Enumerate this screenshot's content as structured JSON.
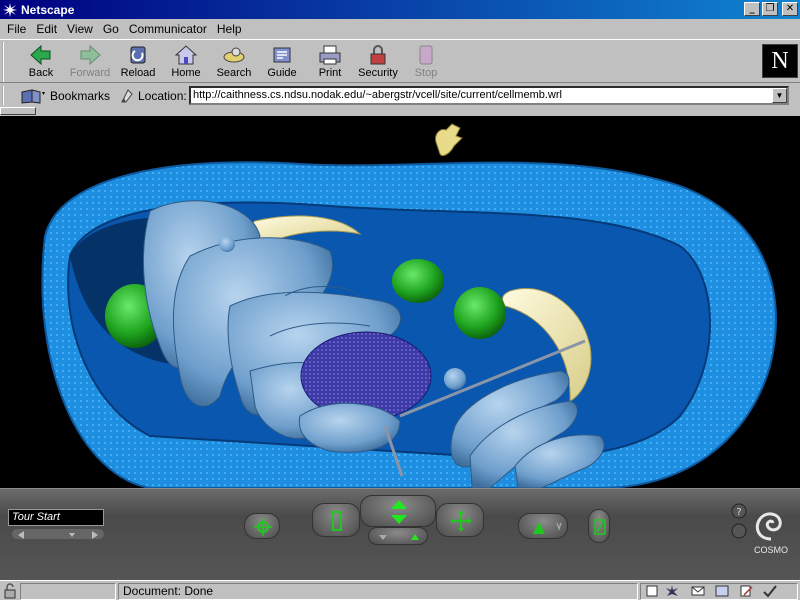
{
  "window": {
    "title": "Netscape"
  },
  "menu": [
    {
      "label": "File",
      "accel": "F"
    },
    {
      "label": "Edit",
      "accel": "E"
    },
    {
      "label": "View",
      "accel": "V"
    },
    {
      "label": "Go",
      "accel": "G"
    },
    {
      "label": "Communicator",
      "accel": "C"
    },
    {
      "label": "Help",
      "accel": "H"
    }
  ],
  "toolbar": {
    "back": "Back",
    "forward": "Forward",
    "reload": "Reload",
    "home": "Home",
    "search": "Search",
    "guide": "Guide",
    "print": "Print",
    "security": "Security",
    "stop": "Stop"
  },
  "logo": {
    "letter": "N"
  },
  "location": {
    "bookmarks_label": "Bookmarks",
    "location_label": "Location:",
    "url": "http://caithness.cs.ndsu.nodak.edu/~abergstr/vcell/site/current/cellmemb.wrl"
  },
  "cosmo": {
    "viewpoint": "Tour Start",
    "brand": "COSMO"
  },
  "status": {
    "text": "Document: Done"
  },
  "colors": {
    "title_start": "#000080",
    "title_end": "#1084d0",
    "cell_blue": "#1e8fe0",
    "organelle": "#7aaed8",
    "chloroplast": "#1fa51f",
    "vacuole": "#f2eab0",
    "nucleus": "#3d3aa8"
  }
}
